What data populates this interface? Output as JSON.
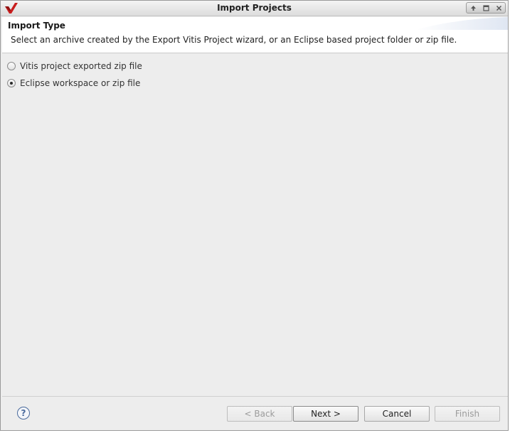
{
  "window": {
    "title": "Import Projects",
    "controls": {
      "minimize_icon": "arrow-up-icon",
      "maximize_icon": "square-icon",
      "close_icon": "close-icon"
    },
    "logo_icon": "vitis-logo",
    "accent_color": "#c81e1e"
  },
  "banner": {
    "title": "Import Type",
    "description": "Select an archive created by the Export Vitis Project wizard, or an Eclipse based project folder or zip file."
  },
  "import_options": [
    {
      "label": "Vitis project exported zip file",
      "selected": false
    },
    {
      "label": "Eclipse workspace or zip file",
      "selected": true
    }
  ],
  "footer": {
    "help_label": "?",
    "back_label": "< Back",
    "next_label": "Next >",
    "cancel_label": "Cancel",
    "finish_label": "Finish"
  }
}
